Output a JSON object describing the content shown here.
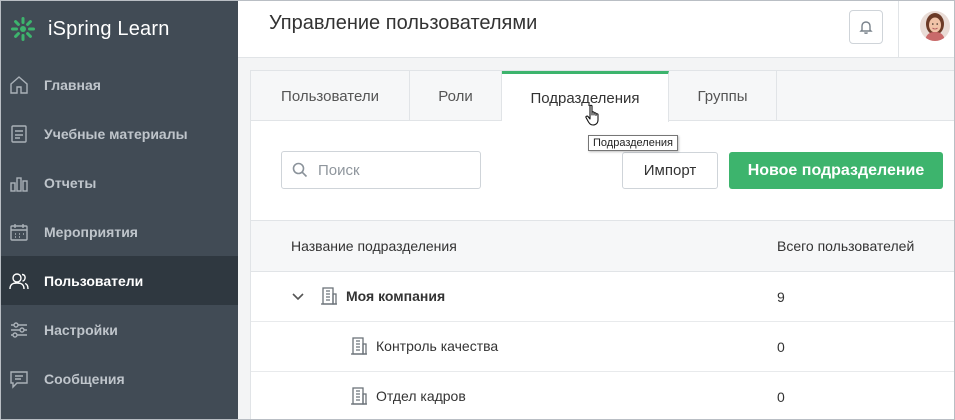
{
  "app": {
    "name": "iSpring Learn"
  },
  "sidebar": {
    "items": [
      {
        "label": "Главная",
        "icon": "home-icon",
        "active": false
      },
      {
        "label": "Учебные материалы",
        "icon": "book-icon",
        "active": false
      },
      {
        "label": "Отчеты",
        "icon": "bar-chart-icon",
        "active": false
      },
      {
        "label": "Мероприятия",
        "icon": "calendar-icon",
        "active": false
      },
      {
        "label": "Пользователи",
        "icon": "users-icon",
        "active": true
      },
      {
        "label": "Настройки",
        "icon": "sliders-icon",
        "active": false
      },
      {
        "label": "Сообщения",
        "icon": "message-icon",
        "active": false
      }
    ]
  },
  "header": {
    "title": "Управление пользователями"
  },
  "tabs": [
    {
      "label": "Пользователи",
      "active": false
    },
    {
      "label": "Роли",
      "active": false
    },
    {
      "label": "Подразделения",
      "active": true
    },
    {
      "label": "Группы",
      "active": false
    }
  ],
  "tooltip": {
    "text": "Подразделения"
  },
  "search": {
    "placeholder": "Поиск",
    "value": ""
  },
  "toolbar": {
    "import_label": "Импорт",
    "new_label": "Новое подразделение"
  },
  "table": {
    "columns": {
      "name": "Название подразделения",
      "count": "Всего пользователей"
    },
    "rows": [
      {
        "name": "Моя компания",
        "count": "9",
        "level": 0,
        "expanded": true
      },
      {
        "name": "Контроль качества",
        "count": "0",
        "level": 1
      },
      {
        "name": "Отдел кадров",
        "count": "0",
        "level": 1
      }
    ]
  },
  "colors": {
    "accent": "#3db46d",
    "sidebar": "#414b55",
    "sidebar_active": "#2f3840"
  }
}
